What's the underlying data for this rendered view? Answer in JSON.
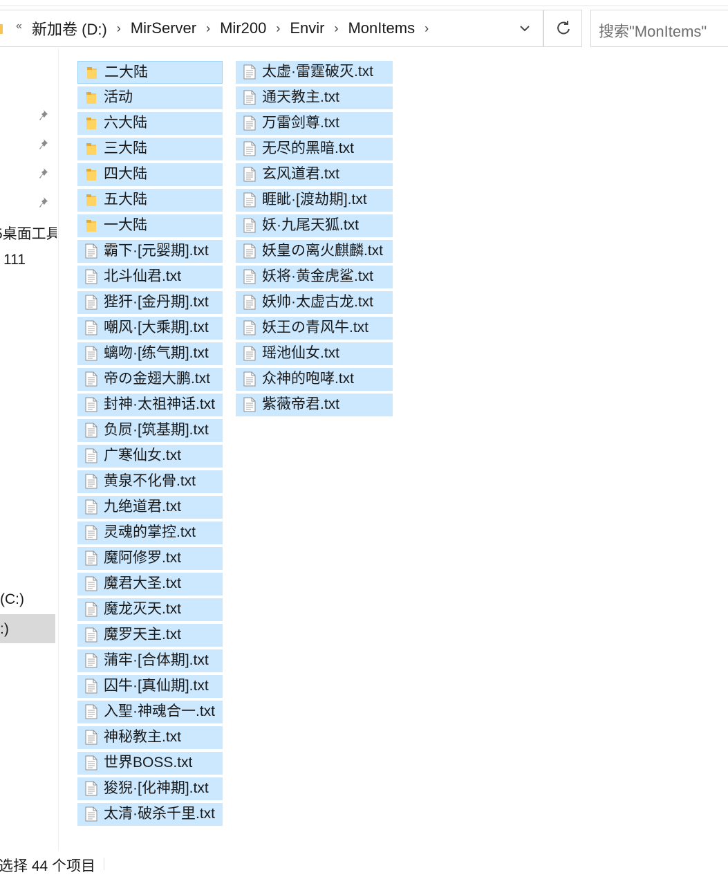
{
  "address": {
    "overflow": "«",
    "crumbs": [
      "新加卷 (D:)",
      "MirServer",
      "Mir200",
      "Envir",
      "MonItems"
    ]
  },
  "search": {
    "placeholder": "搜索\"MonItems\""
  },
  "nav": {
    "quick_access_partial": "5桌面工具",
    "folder_partial": "111",
    "drive_c_partial": "(C:)",
    "drive_d_partial": ":)"
  },
  "items": {
    "col1": [
      {
        "name": "二大陆",
        "type": "folder"
      },
      {
        "name": "活动",
        "type": "folder"
      },
      {
        "name": "六大陆",
        "type": "folder"
      },
      {
        "name": "三大陆",
        "type": "folder"
      },
      {
        "name": "四大陆",
        "type": "folder"
      },
      {
        "name": "五大陆",
        "type": "folder"
      },
      {
        "name": "一大陆",
        "type": "folder"
      },
      {
        "name": "霸下·[元婴期].txt",
        "type": "file"
      },
      {
        "name": "北斗仙君.txt",
        "type": "file"
      },
      {
        "name": "狴犴·[金丹期].txt",
        "type": "file"
      },
      {
        "name": "嘲风·[大乘期].txt",
        "type": "file"
      },
      {
        "name": "螭吻·[练气期].txt",
        "type": "file"
      },
      {
        "name": "帝の金翅大鹏.txt",
        "type": "file"
      },
      {
        "name": "封神·太祖神话.txt",
        "type": "file"
      },
      {
        "name": "负屃·[筑基期].txt",
        "type": "file"
      },
      {
        "name": "广寒仙女.txt",
        "type": "file"
      },
      {
        "name": "黄泉不化骨.txt",
        "type": "file"
      },
      {
        "name": "九绝道君.txt",
        "type": "file"
      },
      {
        "name": "灵魂的掌控.txt",
        "type": "file"
      },
      {
        "name": "魔阿修罗.txt",
        "type": "file"
      },
      {
        "name": "魔君大圣.txt",
        "type": "file"
      },
      {
        "name": "魔龙灭天.txt",
        "type": "file"
      },
      {
        "name": "魔罗天主.txt",
        "type": "file"
      },
      {
        "name": "蒲牢·[合体期].txt",
        "type": "file"
      },
      {
        "name": "囚牛·[真仙期].txt",
        "type": "file"
      },
      {
        "name": "入聖·神魂合一.txt",
        "type": "file"
      },
      {
        "name": "神秘教主.txt",
        "type": "file"
      },
      {
        "name": "世界BOSS.txt",
        "type": "file"
      },
      {
        "name": "狻猊·[化神期].txt",
        "type": "file"
      },
      {
        "name": "太清·破杀千里.txt",
        "type": "file"
      }
    ],
    "col2": [
      {
        "name": "太虚·雷霆破灭.txt",
        "type": "file"
      },
      {
        "name": "通天教主.txt",
        "type": "file"
      },
      {
        "name": "万雷剑尊.txt",
        "type": "file"
      },
      {
        "name": "无尽的黑暗.txt",
        "type": "file"
      },
      {
        "name": "玄风道君.txt",
        "type": "file"
      },
      {
        "name": "睚眦·[渡劫期].txt",
        "type": "file"
      },
      {
        "name": "妖·九尾天狐.txt",
        "type": "file"
      },
      {
        "name": "妖皇の离火麒麟.txt",
        "type": "file"
      },
      {
        "name": "妖将·黄金虎鲨.txt",
        "type": "file"
      },
      {
        "name": "妖帅·太虚古龙.txt",
        "type": "file"
      },
      {
        "name": "妖王の青风牛.txt",
        "type": "file"
      },
      {
        "name": "瑶池仙女.txt",
        "type": "file"
      },
      {
        "name": "众神的咆哮.txt",
        "type": "file"
      },
      {
        "name": "紫薇帝君.txt",
        "type": "file"
      }
    ]
  },
  "status": {
    "text": "选择 44 个项目"
  },
  "colors": {
    "selection": "#cce8ff",
    "selection_border": "#99d1ff",
    "folder": "#f8c44f"
  }
}
